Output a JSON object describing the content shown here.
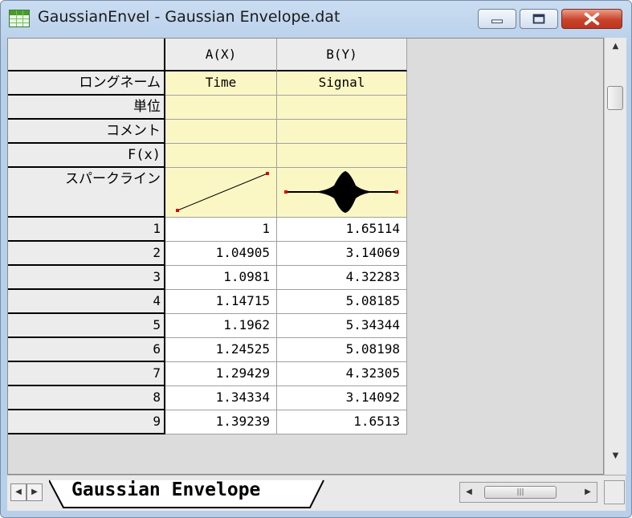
{
  "window": {
    "title": "GaussianEnvel - Gaussian Envelope.dat",
    "buttons": {
      "minimize_icon": "minimize-icon",
      "maximize_icon": "maximize-icon",
      "close_icon": "close-icon"
    }
  },
  "grid": {
    "columns": [
      "A(X)",
      "B(Y)"
    ],
    "meta_rows": [
      {
        "label": "ロングネーム",
        "values": [
          "Time",
          "Signal"
        ]
      },
      {
        "label": "単位",
        "values": [
          "",
          ""
        ]
      },
      {
        "label": "コメント",
        "values": [
          "",
          ""
        ]
      },
      {
        "label": "F(x)",
        "values": [
          "",
          ""
        ]
      },
      {
        "label": "スパークライン",
        "values": [
          "",
          ""
        ]
      }
    ],
    "rows": [
      {
        "index": "1",
        "a": "1",
        "b": "1.65114"
      },
      {
        "index": "2",
        "a": "1.04905",
        "b": "3.14069"
      },
      {
        "index": "3",
        "a": "1.0981",
        "b": "4.32283"
      },
      {
        "index": "4",
        "a": "1.14715",
        "b": "5.08185"
      },
      {
        "index": "5",
        "a": "1.1962",
        "b": "5.34344"
      },
      {
        "index": "6",
        "a": "1.24525",
        "b": "5.08198"
      },
      {
        "index": "7",
        "a": "1.29429",
        "b": "4.32305"
      },
      {
        "index": "8",
        "a": "1.34334",
        "b": "3.14092"
      },
      {
        "index": "9",
        "a": "1.39239",
        "b": "1.6513"
      }
    ]
  },
  "sheet_tab": {
    "label": "Gaussian Envelope"
  },
  "colors": {
    "meta_bg": "#fbf7c5",
    "sparkline_endpoint": "#e00000",
    "close_button": "#c8432b"
  }
}
